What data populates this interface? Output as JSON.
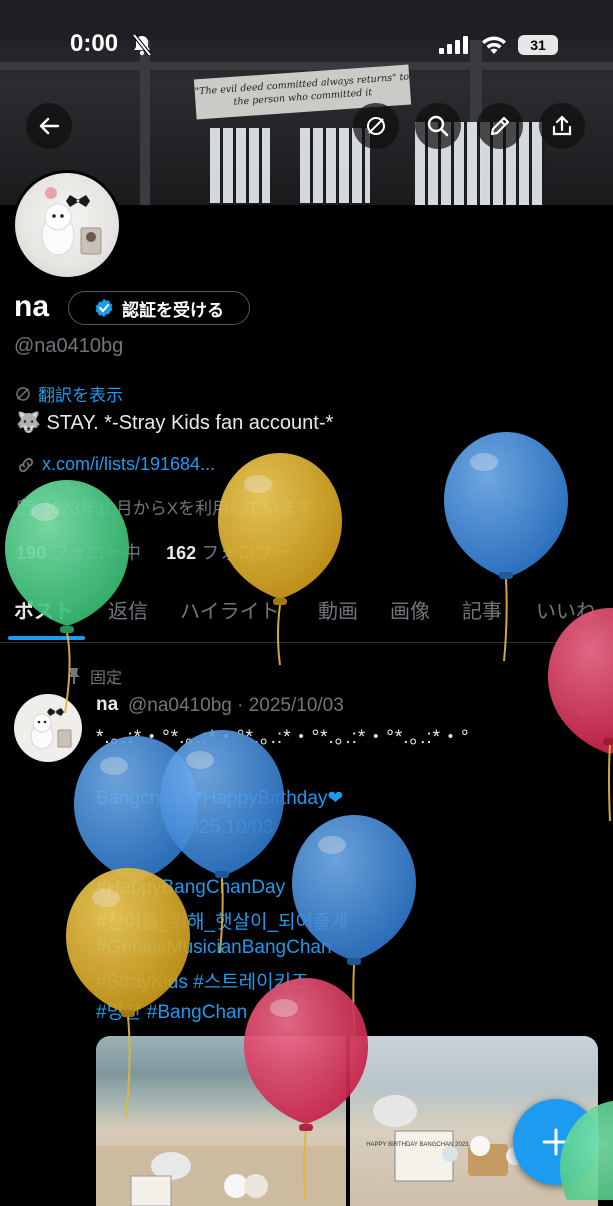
{
  "status_bar": {
    "time": "0:00",
    "battery": "31"
  },
  "banner": {
    "sign_text": "\"The evil deed committed always returns\" to the person who committed it"
  },
  "profile": {
    "name": "na",
    "verify_label": "認証を受ける",
    "handle": "@na0410bg",
    "translate_label": "翻訳を表示",
    "bio": "🐺 STAY. *-Stray Kids fan account-*",
    "link": "x.com/i/lists/191684...",
    "joined": "2023年10月からXを利用しています",
    "following_count": "190",
    "following_label": "フォロー中",
    "followers_count": "162",
    "followers_label": "フォロワー"
  },
  "tabs": [
    {
      "label": "ポスト",
      "active": true
    },
    {
      "label": "返信"
    },
    {
      "label": "ハイライト"
    },
    {
      "label": "動画"
    },
    {
      "label": "画像"
    },
    {
      "label": "記事"
    },
    {
      "label": "いいね"
    }
  ],
  "post": {
    "pinned_label": "固定",
    "author": "na",
    "meta": "@na0410bg · 2025/10/03",
    "deco_line": "*.｡.:*・°*.｡.:*・°*.｡.:*・°*.｡.:*・°*.｡.:*・°",
    "line1": "Bangchan ❤HappyBirthday❤",
    "line2": "2025.10/03",
    "tags": [
      "#HappyBangChanDay",
      "#찬이를_위해_햇살이_되어줄게",
      "#GeniusMusicianBangChan",
      "#StrayKids #스트레이키즈",
      "#방찬 #BangChan"
    ],
    "media_caption": "HAPPY BIRTHDAY BANGCHAN 2023 10/3"
  },
  "colors": {
    "accent": "#1d9bf0",
    "balloon_green": "#4fd18a",
    "balloon_yellow": "#e6b72f",
    "balloon_blue": "#3f8fe0",
    "balloon_red": "#e0385e"
  }
}
